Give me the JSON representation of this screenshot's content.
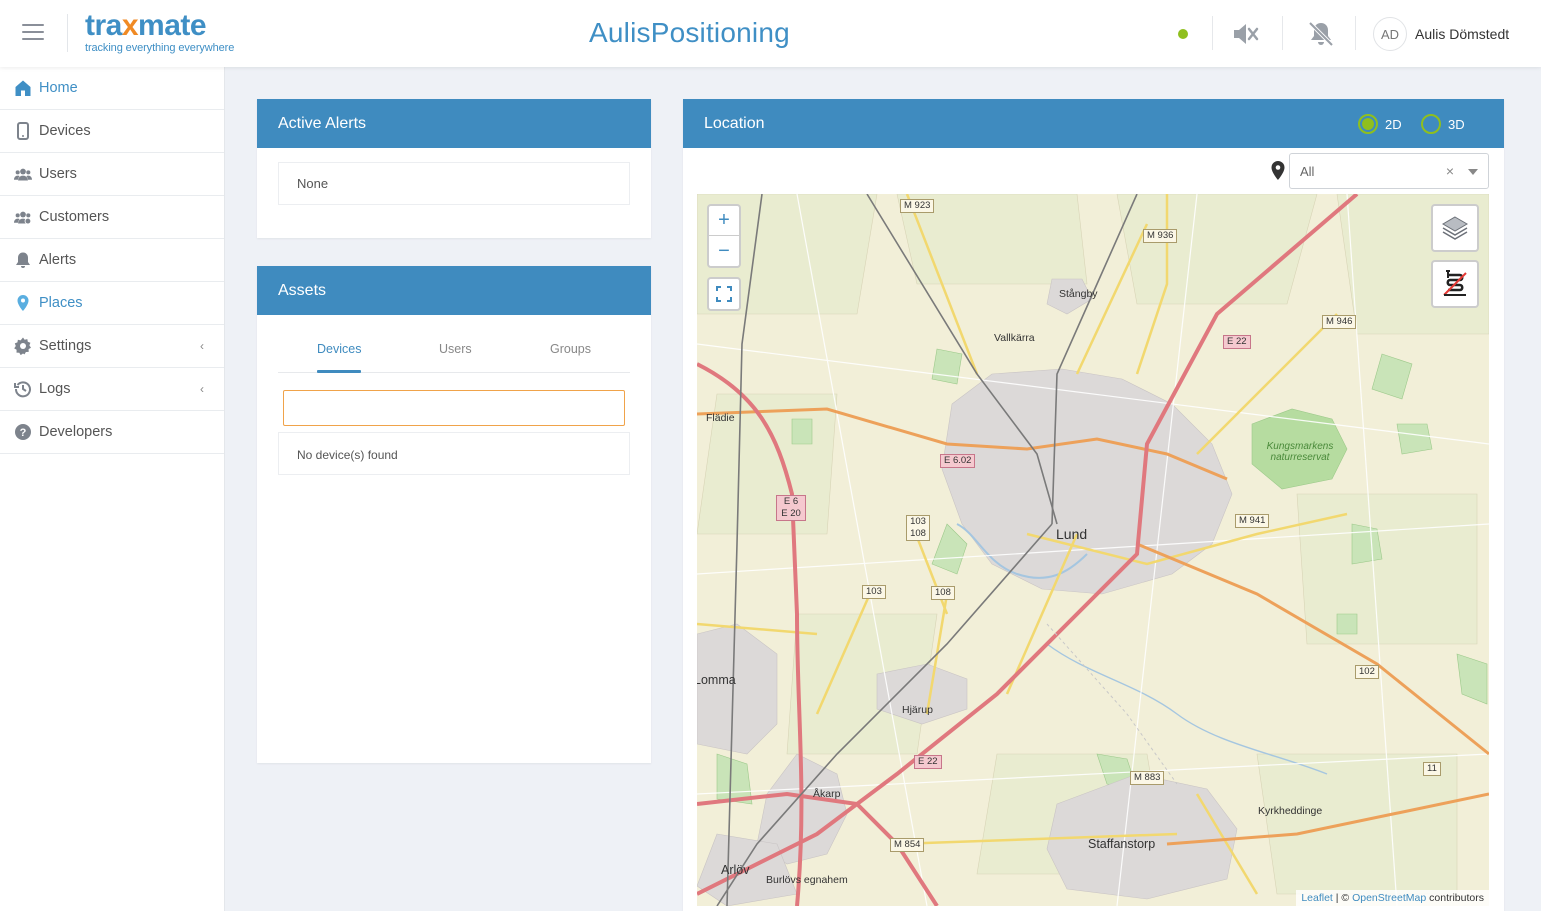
{
  "header": {
    "logo_main_pre": "tra",
    "logo_main_x": "x",
    "logo_main_post": "mate",
    "logo_tagline": "tracking everything everywhere",
    "app_title": "AulisPositioning",
    "user_initials": "AD",
    "user_name": "Aulis Dömstedt",
    "status_color": "#8fbf1e"
  },
  "sidebar": {
    "items": [
      {
        "label": "Home",
        "icon": "home-icon",
        "active": true
      },
      {
        "label": "Devices",
        "icon": "device-icon"
      },
      {
        "label": "Users",
        "icon": "users-icon"
      },
      {
        "label": "Customers",
        "icon": "customers-icon"
      },
      {
        "label": "Alerts",
        "icon": "bell-icon"
      },
      {
        "label": "Places",
        "icon": "map-pin-icon",
        "active": true
      },
      {
        "label": "Settings",
        "icon": "gear-icon",
        "expandable": true
      },
      {
        "label": "Logs",
        "icon": "history-icon",
        "expandable": true
      },
      {
        "label": "Developers",
        "icon": "help-icon"
      }
    ]
  },
  "alerts": {
    "title": "Active Alerts",
    "empty_text": "None"
  },
  "assets": {
    "title": "Assets",
    "tabs": [
      "Devices",
      "Users",
      "Groups"
    ],
    "active_tab": "Devices",
    "search_value": "",
    "empty_text": "No device(s) found"
  },
  "location": {
    "title": "Location",
    "view_2d": "2D",
    "view_3d": "3D",
    "selected_view": "2D",
    "filter_value": "All",
    "clear_symbol": "×",
    "zoom_in": "+",
    "zoom_out": "−",
    "attribution_leaflet": "Leaflet",
    "attribution_sep": " | © ",
    "attribution_osm": "OpenStreetMap",
    "attribution_tail": " contributors",
    "map_labels": {
      "lund": "Lund",
      "staffanstorp": "Staffanstorp",
      "lomma": "Lomma",
      "arlov": "Arlöv",
      "stangby": "Stångby",
      "vallkarra": "Vallkärra",
      "fladie": "Flädie",
      "hjarup": "Hjärup",
      "akarp": "Åkarp",
      "burlovs": "Burlövs egnahem",
      "kyrkheddinge": "Kyrkheddinge",
      "kungsmarken": "Kungsmarkens naturreservat",
      "m923": "M 923",
      "m936": "M 936",
      "m946": "M 946",
      "m941": "M 941",
      "m883": "M 883",
      "m854": "M 854",
      "e22a": "E 22",
      "e22b": "E 22",
      "e602": "E 6.02",
      "e6e20": "E 6 E 20",
      "r103108": "103 108",
      "r103": "103",
      "r108": "108",
      "r102": "102",
      "r11": "11"
    }
  }
}
